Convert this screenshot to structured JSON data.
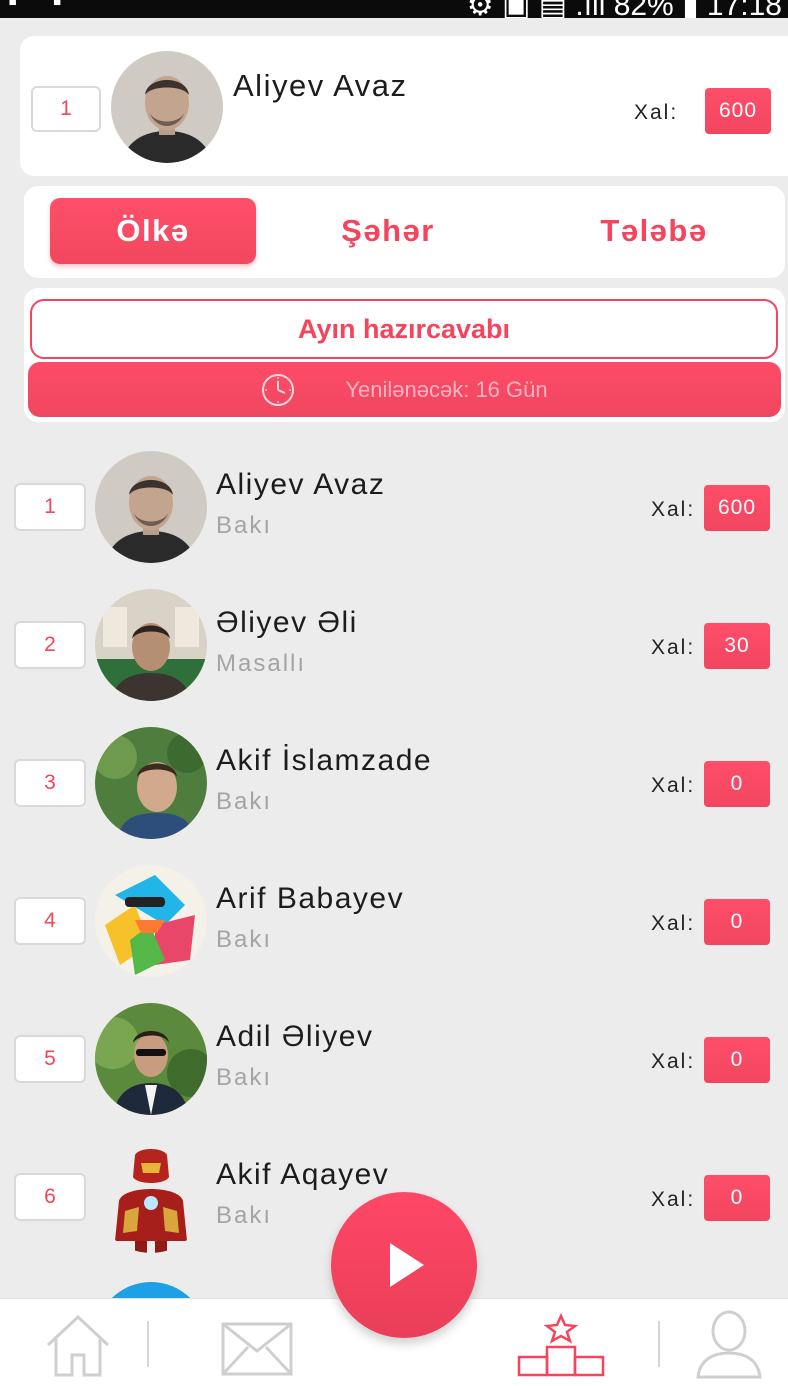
{
  "status_bar": {
    "left_icons": "▪ ▪",
    "right_text": "⚙ ▣ ▤ .ıll 82% ▮ 17:18"
  },
  "current_user": {
    "rank": "1",
    "name": "Aliyev Avaz",
    "points_label": "Xal:",
    "points": "600"
  },
  "tabs": [
    {
      "label": "Ölkə",
      "active": true
    },
    {
      "label": "Şəhər",
      "active": false
    },
    {
      "label": "Tələbə",
      "active": false
    }
  ],
  "monthly": {
    "title": "Ayın hazırcavabı",
    "refresh_text": "Yenilənəcək: 16 Gün"
  },
  "leaderboard": [
    {
      "rank": "1",
      "name": "Aliyev Avaz",
      "city": "Bakı",
      "points_label": "Xal:",
      "points": "600"
    },
    {
      "rank": "2",
      "name": "Əliyev Əli",
      "city": "Masallı",
      "points_label": "Xal:",
      "points": "30"
    },
    {
      "rank": "3",
      "name": "Akif İslamzade",
      "city": "Bakı",
      "points_label": "Xal:",
      "points": "0"
    },
    {
      "rank": "4",
      "name": "Arif Babayev",
      "city": "Bakı",
      "points_label": "Xal:",
      "points": "0"
    },
    {
      "rank": "5",
      "name": "Adil Əliyev",
      "city": "Bakı",
      "points_label": "Xal:",
      "points": "0"
    },
    {
      "rank": "6",
      "name": "Akif Aqayev",
      "city": "Bakı",
      "points_label": "Xal:",
      "points": "0"
    }
  ],
  "bottom_nav": {
    "items": [
      {
        "icon": "home-icon"
      },
      {
        "icon": "mail-icon"
      },
      {
        "icon": "leaderboard-icon",
        "active": true
      },
      {
        "icon": "profile-icon"
      }
    ],
    "fab_icon": "play-icon"
  },
  "colors": {
    "accent": "#f5445c",
    "background": "#ececec",
    "card": "#ffffff",
    "muted_text": "#a4a4a4",
    "inactive_icon": "#cfcfcf"
  }
}
